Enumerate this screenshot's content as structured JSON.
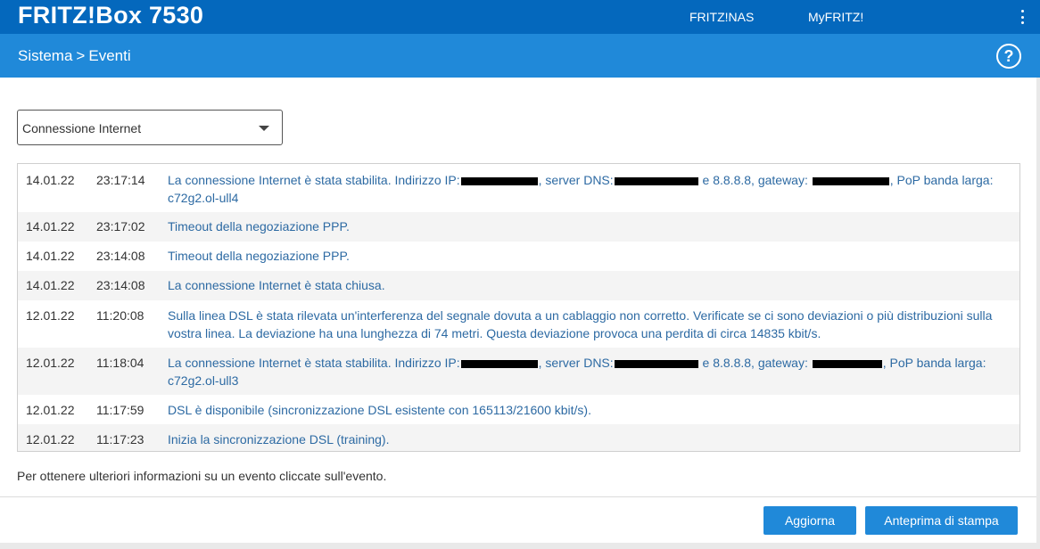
{
  "header": {
    "brand": "FRITZ!Box 7530",
    "nav": [
      "FRITZ!NAS",
      "MyFRITZ!"
    ],
    "menu_icon": "vertical-dots-icon"
  },
  "breadcrumb": {
    "parent": "Sistema",
    "separator": ">",
    "current": "Eventi",
    "help_icon": "help-circle-icon",
    "help_symbol": "?"
  },
  "filter": {
    "selected": "Connessione Internet"
  },
  "events": [
    {
      "date": "14.01.22",
      "time": "23:17:14",
      "message_parts": [
        "La connessione Internet è stata stabilita. Indirizzo IP:",
        ", server DNS:",
        "e 8.8.8.8, gateway:",
        ", PoP banda larga: c72g2.ol-ull4"
      ]
    },
    {
      "date": "14.01.22",
      "time": "23:17:02",
      "message": "Timeout della negoziazione PPP."
    },
    {
      "date": "14.01.22",
      "time": "23:14:08",
      "message": "Timeout della negoziazione PPP."
    },
    {
      "date": "14.01.22",
      "time": "23:14:08",
      "message": "La connessione Internet è stata chiusa."
    },
    {
      "date": "12.01.22",
      "time": "11:20:08",
      "message": "Sulla linea DSL è stata rilevata un'interferenza del segnale dovuta a un cablaggio non corretto. Verificate se ci sono deviazioni o più distribuzioni sulla vostra linea. La deviazione ha una lunghezza di 74 metri. Questa deviazione provoca una perdita di circa 14835 kbit/s."
    },
    {
      "date": "12.01.22",
      "time": "11:18:04",
      "message_parts": [
        "La connessione Internet è stata stabilita. Indirizzo IP:",
        ", server DNS:",
        "e 8.8.8.8, gateway:",
        ", PoP banda larga: c72g2.ol-ull3"
      ]
    },
    {
      "date": "12.01.22",
      "time": "11:17:59",
      "message": "DSL è disponibile (sincronizzazione DSL esistente con 165113/21600 kbit/s)."
    },
    {
      "date": "12.01.22",
      "time": "11:17:23",
      "message": "Inizia la sincronizzazione DSL (training)."
    }
  ],
  "info_text": "Per ottenere ulteriori informazioni su un evento cliccate sull'evento.",
  "buttons": {
    "refresh": "Aggiorna",
    "print_preview": "Anteprima di stampa"
  },
  "colors": {
    "header_blue": "#0468bd",
    "breadcrumb_blue": "#2089d9",
    "link_text": "#2d6aa3",
    "button_blue": "#2089d9"
  }
}
